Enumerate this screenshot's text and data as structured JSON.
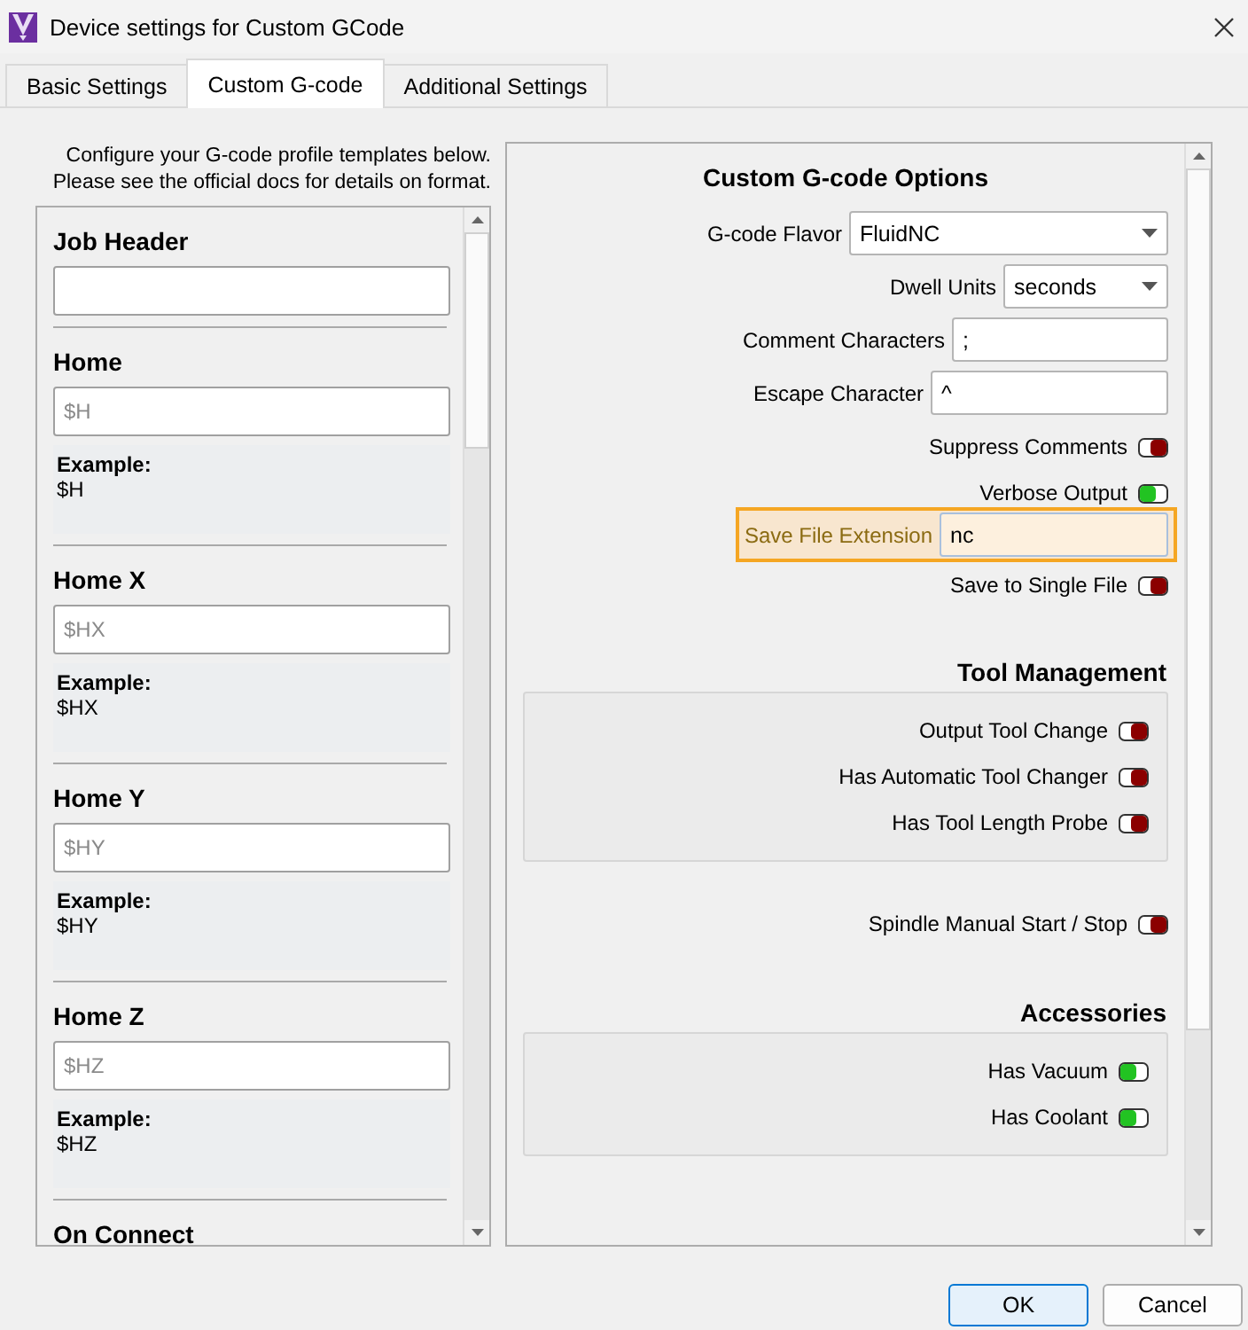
{
  "window": {
    "title": "Device settings for Custom GCode"
  },
  "tabs": [
    {
      "label": "Basic Settings",
      "selected": false
    },
    {
      "label": "Custom G-code",
      "selected": true
    },
    {
      "label": "Additional Settings",
      "selected": false
    }
  ],
  "intro_lines": [
    "Configure your G-code profile templates below.",
    "Please see the official docs for details on format."
  ],
  "templates": [
    {
      "kind": "field",
      "title": "Job Header"
    },
    {
      "kind": "example",
      "title": "Home",
      "placeholder": "$H",
      "example_label": "Example:",
      "example": "$H"
    },
    {
      "kind": "example",
      "title": "Home X",
      "placeholder": "$HX",
      "example_label": "Example:",
      "example": "$HX"
    },
    {
      "kind": "example",
      "title": "Home Y",
      "placeholder": "$HY",
      "example_label": "Example:",
      "example": "$HY"
    },
    {
      "kind": "example",
      "title": "Home Z",
      "placeholder": "$HZ",
      "example_label": "Example:",
      "example": "$HZ"
    },
    {
      "kind": "heading",
      "title": "On Connect"
    }
  ],
  "options": {
    "title": "Custom G-code Options",
    "rows": [
      {
        "kind": "select",
        "label": "G-code Flavor",
        "value": "FluidNC",
        "highlighted": false
      },
      {
        "kind": "select",
        "label": "Dwell Units",
        "value": "seconds",
        "highlighted": false
      },
      {
        "kind": "input",
        "label": "Comment Characters",
        "value": ";",
        "highlighted": false
      },
      {
        "kind": "input",
        "label": "Escape Character",
        "value": "^",
        "highlighted": false
      },
      {
        "kind": "toggle",
        "label": "Suppress Comments",
        "on": false
      },
      {
        "kind": "toggle",
        "label": "Verbose Output",
        "on": true
      },
      {
        "kind": "input",
        "label": "Save File Extension",
        "value": "nc",
        "highlighted": true
      },
      {
        "kind": "toggle",
        "label": "Save to Single File",
        "on": false
      }
    ]
  },
  "sections": [
    {
      "title": "Tool Management",
      "boxed": true,
      "rows": [
        {
          "label": "Output Tool Change",
          "on": false
        },
        {
          "label": "Has Automatic Tool Changer",
          "on": false
        },
        {
          "label": "Has Tool Length Probe",
          "on": false
        }
      ]
    },
    {
      "boxed": false,
      "rows": [
        {
          "label": "Spindle Manual Start / Stop",
          "on": false
        }
      ]
    },
    {
      "title": "Accessories",
      "boxed": true,
      "rows": [
        {
          "label": "Has Vacuum",
          "on": true
        },
        {
          "label": "Has Coolant",
          "on": true
        }
      ]
    }
  ],
  "buttons": [
    {
      "label": "OK",
      "default": true
    },
    {
      "label": "Cancel",
      "default": false
    }
  ]
}
